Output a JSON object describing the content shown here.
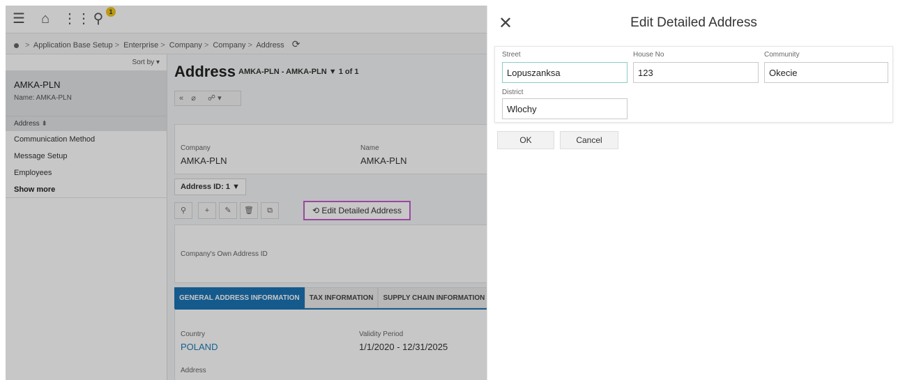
{
  "topbar": {
    "notification_count": "1"
  },
  "breadcrumb": {
    "items": [
      "Application Base Setup",
      "Enterprise",
      "Company",
      "Company",
      "Address"
    ]
  },
  "nav": {
    "sort_label": "Sort by",
    "record_title": "AMKA-PLN",
    "record_sub": "Name:  AMKA-PLN",
    "active_item": "Address",
    "items": [
      "Communication Method",
      "Message Setup",
      "Employees"
    ],
    "show_more": "Show more"
  },
  "main": {
    "title": "Address",
    "subtitle": "AMKA-PLN - AMKA-PLN",
    "count": "1 of 1",
    "company_label": "Company",
    "company_value": "AMKA-PLN",
    "name_label": "Name",
    "name_value": "AMKA-PLN",
    "address_id": "Address ID: 1",
    "edit_link": "Edit Detailed Address",
    "own_address_label": "Company's Own Address ID",
    "tabs": [
      "GENERAL ADDRESS INFORMATION",
      "TAX INFORMATION",
      "SUPPLY CHAIN INFORMATION"
    ],
    "country_label": "Country",
    "country_value": "POLAND",
    "validity_label": "Validity Period",
    "validity_value": "1/1/2020 - 12/31/2025",
    "address_label": "Address"
  },
  "dialog": {
    "title": "Edit Detailed Address",
    "street_label": "Street",
    "street_value": "Lopuszanksa",
    "house_label": "House No",
    "house_value": "123",
    "community_label": "Community",
    "community_value": "Okecie",
    "district_label": "District",
    "district_value": "Wlochy",
    "ok_label": "OK",
    "cancel_label": "Cancel"
  },
  "colors": {
    "accent": "#1c74b4",
    "highlight": "#c65ccd",
    "badge": "#f0c419",
    "focus": "#8ccbc7"
  }
}
